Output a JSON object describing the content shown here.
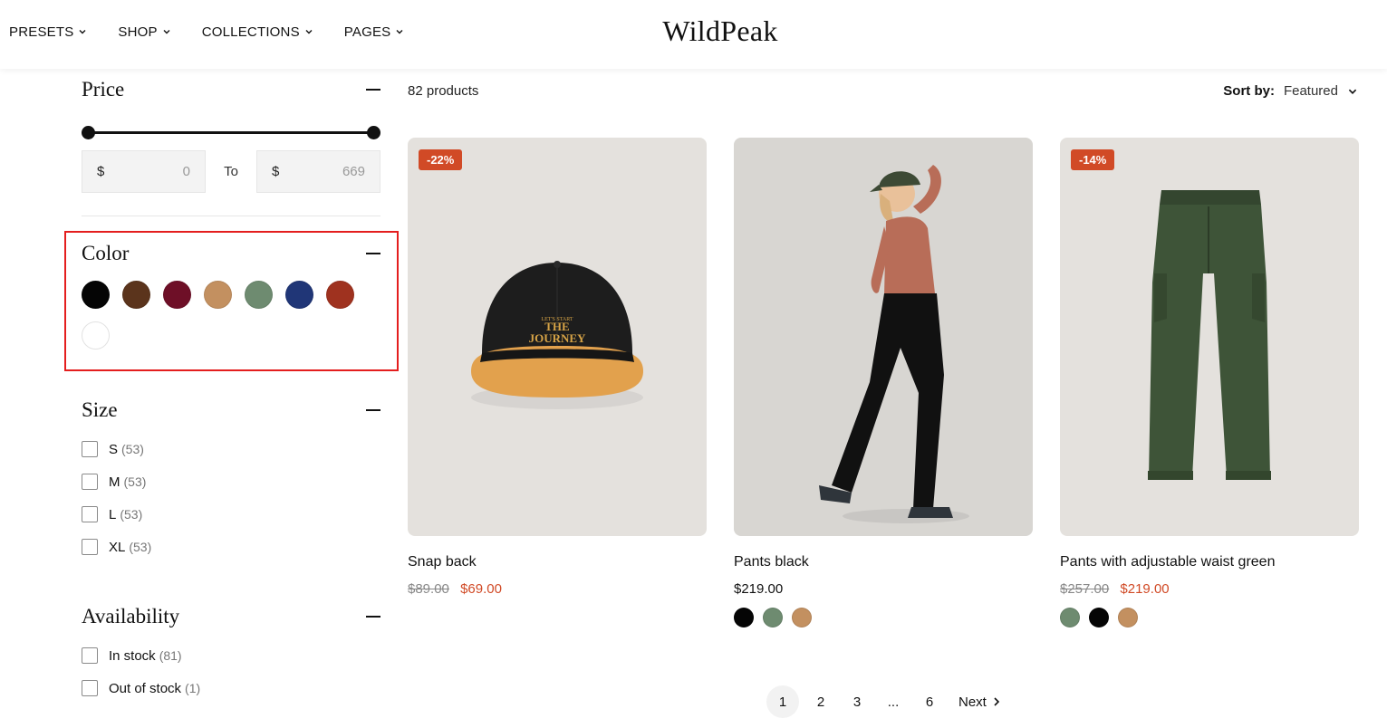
{
  "header": {
    "logo": "WildPeak",
    "nav": [
      {
        "label": "PRESETS"
      },
      {
        "label": "SHOP"
      },
      {
        "label": "COLLECTIONS"
      },
      {
        "label": "PAGES"
      }
    ]
  },
  "filters": {
    "price": {
      "title": "Price",
      "min_currency": "$",
      "min_value": "0",
      "to_label": "To",
      "max_currency": "$",
      "max_value": "669"
    },
    "color": {
      "title": "Color",
      "swatches": [
        "#050505",
        "#5b341c",
        "#6e0f27",
        "#c39060",
        "#6e8b70",
        "#203677",
        "#9f321f",
        "#ffffff"
      ]
    },
    "size": {
      "title": "Size",
      "options": [
        {
          "label": "S",
          "count": "(53)"
        },
        {
          "label": "M",
          "count": "(53)"
        },
        {
          "label": "L",
          "count": "(53)"
        },
        {
          "label": "XL",
          "count": "(53)"
        }
      ]
    },
    "availability": {
      "title": "Availability",
      "options": [
        {
          "label": "In stock",
          "count": "(81)"
        },
        {
          "label": "Out of stock",
          "count": "(1)"
        }
      ]
    }
  },
  "listing": {
    "count_label": "82 products",
    "sort_label": "Sort by:",
    "sort_value": "Featured"
  },
  "products": [
    {
      "name": "Snap back",
      "badge": "-22%",
      "old_price": "$89.00",
      "price": "$69.00",
      "cap_text_top": "LET'S START",
      "cap_text_main": "THE",
      "cap_text_main2": "JOURNEY",
      "swatches": []
    },
    {
      "name": "Pants black",
      "badge": "",
      "old_price": "",
      "price": "$219.00",
      "swatches": [
        "#050505",
        "#6e8b70",
        "#c39060"
      ]
    },
    {
      "name": "Pants with adjustable waist green",
      "badge": "-14%",
      "old_price": "$257.00",
      "price": "$219.00",
      "swatches": [
        "#6e8b70",
        "#050505",
        "#c39060"
      ]
    }
  ],
  "pagination": {
    "pages": [
      "1",
      "2",
      "3",
      "...",
      "6"
    ],
    "next": "Next"
  }
}
